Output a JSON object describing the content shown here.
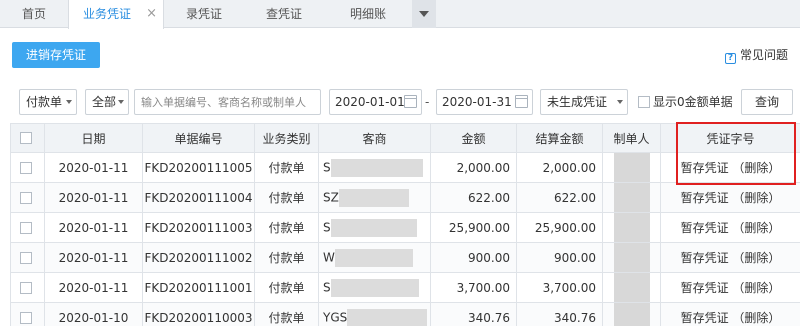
{
  "tabs": [
    {
      "label": "首页",
      "active": false
    },
    {
      "label": "业务凭证",
      "active": true
    },
    {
      "label": "录凭证",
      "active": false
    },
    {
      "label": "查凭证",
      "active": false
    },
    {
      "label": "明细账",
      "active": false
    }
  ],
  "toolbar": {
    "primary_button": "进销存凭证",
    "help_label": "常见问题"
  },
  "filters": {
    "type_select": "付款单",
    "scope_select": "全部",
    "search_placeholder": "输入单据编号、客商名称或制单人",
    "date_from": "2020-01-01",
    "date_to": "2020-01-31",
    "status_select": "未生成凭证",
    "show_zero_label": "显示0金额单据",
    "query_button": "查询"
  },
  "table": {
    "headers": [
      "日期",
      "单据编号",
      "业务类别",
      "客商",
      "金额",
      "结算金额",
      "制单人",
      "凭证字号"
    ],
    "rows": [
      {
        "date": "2020-01-11",
        "doc_no": "FKD20200111005",
        "category": "付款单",
        "partner": "S",
        "amount": "2,000.00",
        "settle": "2,000.00",
        "voucher": "暂存凭证",
        "delete": "（删除）"
      },
      {
        "date": "2020-01-11",
        "doc_no": "FKD20200111004",
        "category": "付款单",
        "partner": "SZ",
        "amount": "622.00",
        "settle": "622.00",
        "voucher": "暂存凭证",
        "delete": "（删除）"
      },
      {
        "date": "2020-01-11",
        "doc_no": "FKD20200111003",
        "category": "付款单",
        "partner": "S",
        "amount": "25,900.00",
        "settle": "25,900.00",
        "voucher": "暂存凭证",
        "delete": "（删除）"
      },
      {
        "date": "2020-01-11",
        "doc_no": "FKD20200111002",
        "category": "付款单",
        "partner": "W",
        "amount": "900.00",
        "settle": "900.00",
        "voucher": "暂存凭证",
        "delete": "（删除）"
      },
      {
        "date": "2020-01-11",
        "doc_no": "FKD20200111001",
        "category": "付款单",
        "partner": "S",
        "amount": "3,700.00",
        "settle": "3,700.00",
        "voucher": "暂存凭证",
        "delete": "（删除）"
      },
      {
        "date": "2020-01-10",
        "doc_no": "FKD20200110003",
        "category": "付款单",
        "partner": "YGS",
        "amount": "340.76",
        "settle": "340.76",
        "voucher": "暂存凭证",
        "delete": "（删除）"
      }
    ]
  }
}
